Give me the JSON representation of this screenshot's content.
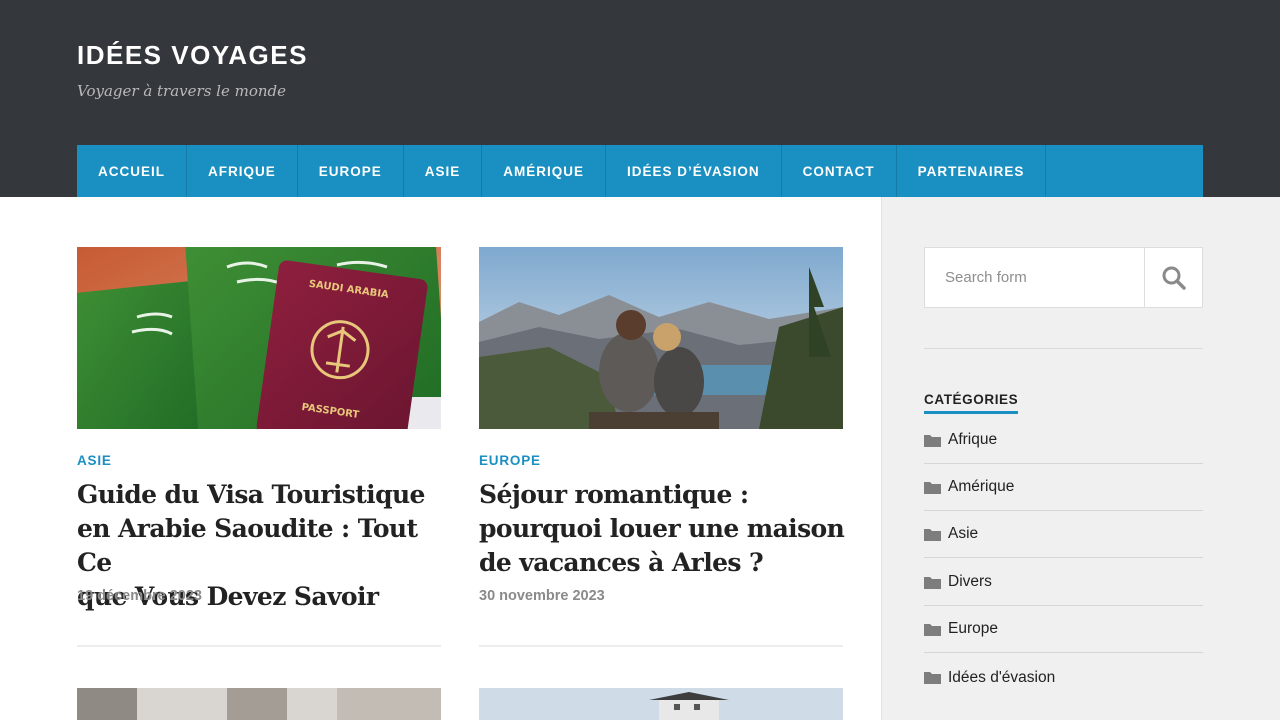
{
  "site": {
    "title": "IDÉES VOYAGES",
    "tagline": "Voyager à travers le monde"
  },
  "nav": [
    "ACCUEIL",
    "AFRIQUE",
    "EUROPE",
    "ASIE",
    "AMÉRIQUE",
    "IDÉES D’ÉVASION",
    "CONTACT",
    "PARTENAIRES"
  ],
  "posts": [
    {
      "category": "ASIE",
      "title_lines": [
        "Guide du Visa Touristique",
        "en Arabie Saoudite : Tout Ce",
        "que Vous Devez Savoir"
      ],
      "date": "19 décembre 2023",
      "image_text": {
        "country": "SAUDI ARABIA",
        "doc": "PASSPORT"
      }
    },
    {
      "category": "EUROPE",
      "title_lines": [
        "Séjour romantique :",
        "pourquoi louer une maison",
        "de vacances à Arles ?"
      ],
      "date": "30 novembre 2023"
    }
  ],
  "sidebar": {
    "search": {
      "placeholder": "Search form"
    },
    "categories_title": "CATÉGORIES",
    "categories": [
      "Afrique",
      "Amérique",
      "Asie",
      "Divers",
      "Europe",
      "Idées d'évasion"
    ]
  },
  "colors": {
    "header_bg": "#34373c",
    "accent": "#1a8fc1",
    "sidebar_bg": "#f0f0f0"
  },
  "icons": {
    "search": "search-icon",
    "category": "folder-icon"
  }
}
